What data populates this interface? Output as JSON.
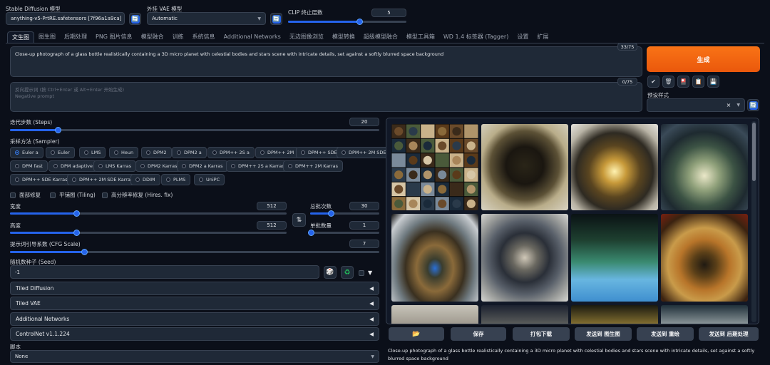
{
  "header": {
    "sd_model_label": "Stable Diffusion 模型",
    "sd_model_value": "anything-v5-PrtRE.safetensors [7f96a1a9ca]",
    "vae_label": "外挂 VAE 模型",
    "vae_value": "Automatic",
    "clip_label": "CLIP 终止层数",
    "clip_value": "5"
  },
  "tabs": [
    "文生图",
    "图生图",
    "后期处理",
    "PNG 图片信息",
    "模型融合",
    "训练",
    "系统信息",
    "Additional Networks",
    "无边图像浏览",
    "模型转换",
    "超级模型融合",
    "模型工具箱",
    "WD 1.4 标签器 (Tagger)",
    "设置",
    "扩展"
  ],
  "prompt": {
    "text": "Close-up photograph of a glass bottle realistically containing a 3D micro planet with celestial bodies and stars scene with intricate details, set against a softly blurred space background",
    "token_count": "33/75",
    "negative_placeholder_line1": "反向提示词 (按 Ctrl+Enter 或 Alt+Enter 开始生成)",
    "negative_placeholder_line2": "Negative prompt",
    "negative_token_count": "0/75"
  },
  "generate": {
    "label": "生成",
    "style_label": "预设样式",
    "style_clear": "×"
  },
  "params": {
    "steps_label": "迭代步数 (Steps)",
    "steps_value": "20",
    "sampler_label": "采样方法 (Sampler)",
    "samplers_row1": [
      "Euler a",
      "Euler",
      "LMS",
      "Heun",
      "DPM2",
      "DPM2 a",
      "DPM++ 2S a",
      "DPM++ 2M",
      "DPM++ SDE",
      "DPM++ 2M SDE"
    ],
    "samplers_row2": [
      "DPM fast",
      "DPM adaptive",
      "LMS Karras",
      "DPM2 Karras",
      "DPM2 a Karras",
      "DPM++ 2S a Karras",
      "DPM++ 2M Karras"
    ],
    "samplers_row3": [
      "DPM++ SDE Karras",
      "DPM++ 2M SDE Karras",
      "DDIM",
      "PLMS",
      "UniPC"
    ],
    "selected_sampler": "Euler a",
    "checkbox_restore": "面部修复",
    "checkbox_tiling": "平铺图 (Tiling)",
    "checkbox_hires": "高分辨率修复 (Hires. fix)",
    "width_label": "宽度",
    "width_value": "512",
    "height_label": "高度",
    "height_value": "512",
    "batch_count_label": "总批次数",
    "batch_count_value": "30",
    "batch_size_label": "单批数量",
    "batch_size_value": "1",
    "cfg_label": "提示词引导系数 (CFG Scale)",
    "cfg_value": "7",
    "seed_label": "随机数种子 (Seed)",
    "seed_value": "-1",
    "swap_icon": "⇅",
    "dice_icon": "🎲",
    "recycle_icon": "♻",
    "expand_icon": "▼"
  },
  "sliders": {
    "clip": 0.6,
    "steps": 0.13,
    "width": 0.24,
    "height": 0.24,
    "batch_count": 0.3,
    "batch_size": 0.01,
    "cfg": 0.2
  },
  "accordions": [
    {
      "label": "Tiled Diffusion",
      "arrow": "◀"
    },
    {
      "label": "Tiled VAE",
      "arrow": "◀"
    },
    {
      "label": "Additional Networks",
      "arrow": "◀"
    },
    {
      "label": "ControlNet v1.1.224",
      "arrow": "◀"
    }
  ],
  "script": {
    "label": "脚本",
    "value": "None"
  },
  "gallery_actions": [
    "📂",
    "保存",
    "打包下载",
    "发送到 图生图",
    "发送到 重绘",
    "发送到 后期处理"
  ],
  "output_caption": "Close-up photograph of a glass bottle realistically containing a 3D micro planet with celestial bodies and stars scene with intricate details, set against a softly blurred space background",
  "icons": {
    "refresh": "🔄",
    "check": "✔",
    "trash": "🗑",
    "style_apply": "🎴",
    "clipboard": "📋",
    "save": "💾"
  },
  "colors": {
    "accent_orange": "#f97316",
    "primary_blue": "#2563eb",
    "background": "#0b0f19"
  }
}
